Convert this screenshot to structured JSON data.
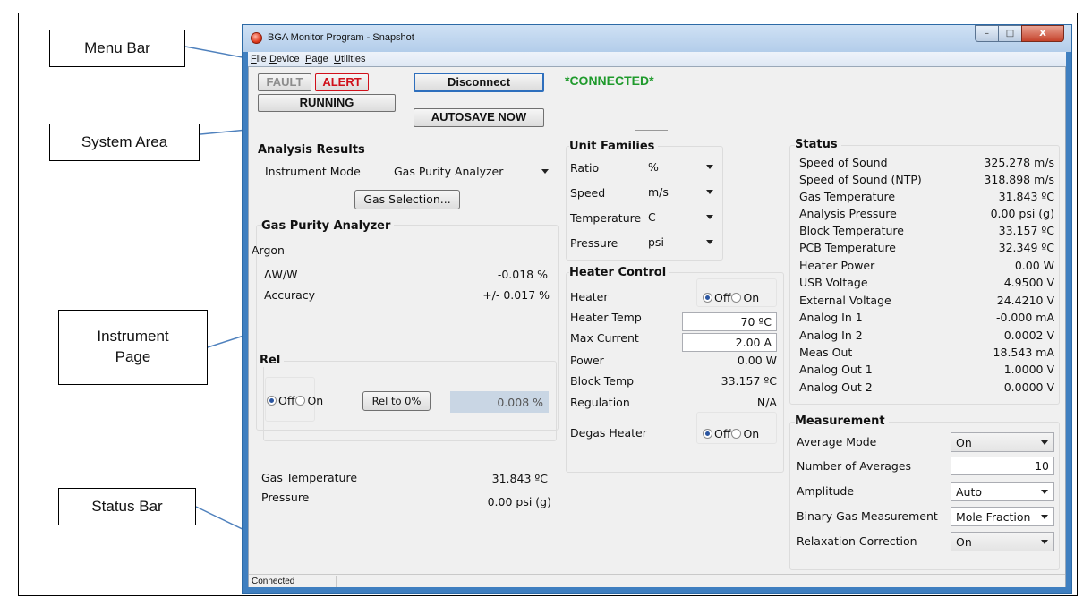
{
  "callouts": {
    "menu_bar": "Menu Bar",
    "system_area": "System Area",
    "instrument_page_line1": "Instrument",
    "instrument_page_line2": "Page",
    "status_bar": "Status Bar"
  },
  "window": {
    "title": "BGA Monitor Program - Snapshot",
    "min_glyph": "–",
    "max_glyph": "□",
    "close_glyph": "X"
  },
  "menu": [
    "File",
    "Device",
    "Page",
    "Utilities"
  ],
  "system": {
    "fault": "FAULT",
    "alert": "ALERT",
    "running": "RUNNING",
    "disconnect": "Disconnect",
    "autosave": "AUTOSAVE NOW",
    "connection_status": "*CONNECTED*",
    "colors": {
      "alert": "#d0101a",
      "fault": "#8c8c8c",
      "connected": "#1f9a2c"
    }
  },
  "analysis": {
    "title": "Analysis Results",
    "mode_label": "Instrument Mode",
    "mode_value": "Gas Purity Analyzer",
    "gas_selection_button": "Gas Selection...",
    "gpa_title": "Gas Purity Analyzer",
    "gas_name": "Argon",
    "rows": [
      {
        "label": "ΔW/W",
        "value": "-0.018 %"
      },
      {
        "label": "Accuracy",
        "value": "+/- 0.017 %"
      }
    ],
    "rel": {
      "title": "Rel",
      "off": "Off",
      "on": "On",
      "button": "Rel to 0%",
      "value": "0.008 %"
    },
    "gas_temperature_label": "Gas Temperature",
    "gas_temperature_value": "31.843 ºC",
    "pressure_label": "Pressure",
    "pressure_value": "0.00 psi (g)"
  },
  "units": {
    "title": "Unit Families",
    "rows": [
      {
        "label": "Ratio",
        "value": "%"
      },
      {
        "label": "Speed",
        "value": "m/s"
      },
      {
        "label": "Temperature",
        "value": "C"
      },
      {
        "label": "Pressure",
        "value": "psi"
      }
    ]
  },
  "heater": {
    "title": "Heater Control",
    "heater_label": "Heater",
    "off": "Off",
    "on": "On",
    "heater_temp_label": "Heater Temp",
    "heater_temp_value": "70 ºC",
    "max_current_label": "Max Current",
    "max_current_value": "2.00 A",
    "power_label": "Power",
    "power_value": "0.00 W",
    "block_temp_label": "Block Temp",
    "block_temp_value": "33.157 ºC",
    "regulation_label": "Regulation",
    "regulation_value": "N/A",
    "degas_label": "Degas Heater"
  },
  "status": {
    "title": "Status",
    "rows": [
      {
        "label": "Speed of Sound",
        "value": "325.278 m/s"
      },
      {
        "label": "Speed of Sound (NTP)",
        "value": "318.898 m/s"
      },
      {
        "label": "Gas Temperature",
        "value": "31.843 ºC"
      },
      {
        "label": "Analysis Pressure",
        "value": "0.00 psi (g)"
      },
      {
        "label": "Block Temperature",
        "value": "33.157 ºC"
      },
      {
        "label": "PCB Temperature",
        "value": "32.349 ºC"
      },
      {
        "label": "Heater Power",
        "value": "0.00 W"
      },
      {
        "label": "USB Voltage",
        "value": "4.9500 V"
      },
      {
        "label": "External Voltage",
        "value": "24.4210 V"
      },
      {
        "label": "Analog In 1",
        "value": "-0.000 mA"
      },
      {
        "label": "Analog In 2",
        "value": "0.0002 V"
      },
      {
        "label": "Meas Out",
        "value": "18.543 mA"
      },
      {
        "label": "Analog Out 1",
        "value": "1.0000 V"
      },
      {
        "label": "Analog Out 2",
        "value": "0.0000 V"
      }
    ]
  },
  "measurement": {
    "title": "Measurement",
    "average_mode_label": "Average Mode",
    "average_mode_value": "On",
    "num_averages_label": "Number of Averages",
    "num_averages_value": "10",
    "amplitude_label": "Amplitude",
    "amplitude_value": "Auto",
    "binary_label": "Binary Gas Measurement",
    "binary_value": "Mole Fraction",
    "relaxation_label": "Relaxation Correction",
    "relaxation_value": "On"
  },
  "statusbar": {
    "text": "Connected"
  }
}
